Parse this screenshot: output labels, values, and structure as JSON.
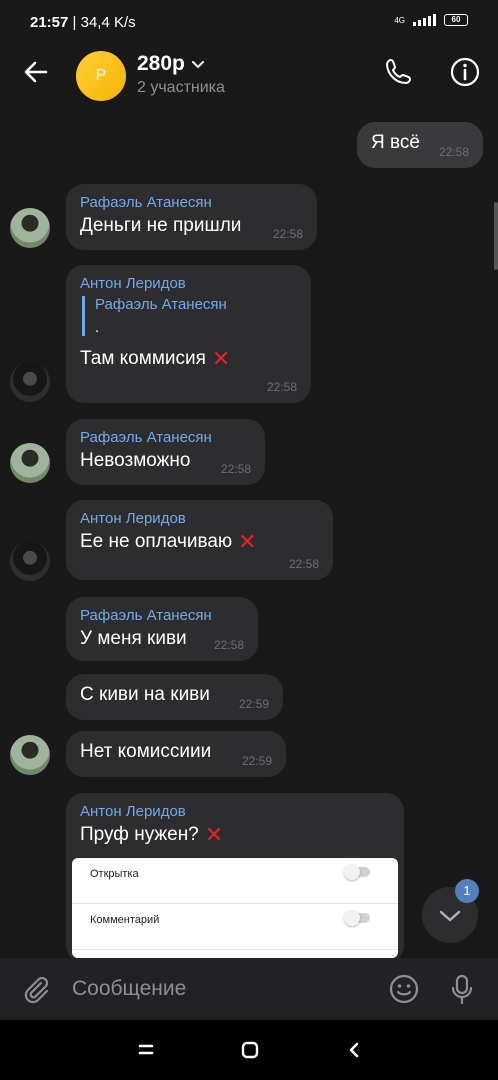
{
  "status_bar": {
    "time": "21:57",
    "extra": "| 34,4 K/s",
    "network": "4G",
    "battery": "60"
  },
  "header": {
    "title": "280р",
    "subtitle": "2 участника",
    "avatar_letter": "Р"
  },
  "messages": [
    {
      "id": "m1",
      "own": true,
      "text": "Я всё",
      "time": "22:58"
    },
    {
      "id": "m2",
      "sender": "Рафаэль Атанесян",
      "text": "Деньги не пришли",
      "time": "22:58"
    },
    {
      "id": "m3",
      "sender": "Антон Леридов",
      "quote_sender": "Рафаэль Атанесян",
      "quote_text": ".",
      "text": "Там коммисия",
      "cross": "✕",
      "time": "22:58"
    },
    {
      "id": "m4",
      "sender": "Рафаэль Атанесян",
      "text": "Невозможно",
      "time": "22:58"
    },
    {
      "id": "m5",
      "sender": "Антон Леридов",
      "text": "Ее не оплачиваю",
      "cross": "✕",
      "time": "22:58"
    },
    {
      "id": "m6",
      "sender": "Рафаэль Атанесян",
      "text": "У меня киви",
      "time": "22:58"
    },
    {
      "id": "m7",
      "text": "С киви на киви",
      "time": "22:59"
    },
    {
      "id": "m8",
      "text": "Нет комиссиии",
      "time": "22:59"
    },
    {
      "id": "m9",
      "sender": "Антон Леридов",
      "text": "Пруф нужен?",
      "cross": "✕"
    }
  ],
  "attachment_rows": [
    "Открытка",
    "Комментарий"
  ],
  "scroll_badge": "1",
  "composer": {
    "placeholder": "Сообщение"
  },
  "colors": {
    "accent": "#71aaeb",
    "cross": "#e6202a",
    "badge": "#5181b8"
  }
}
